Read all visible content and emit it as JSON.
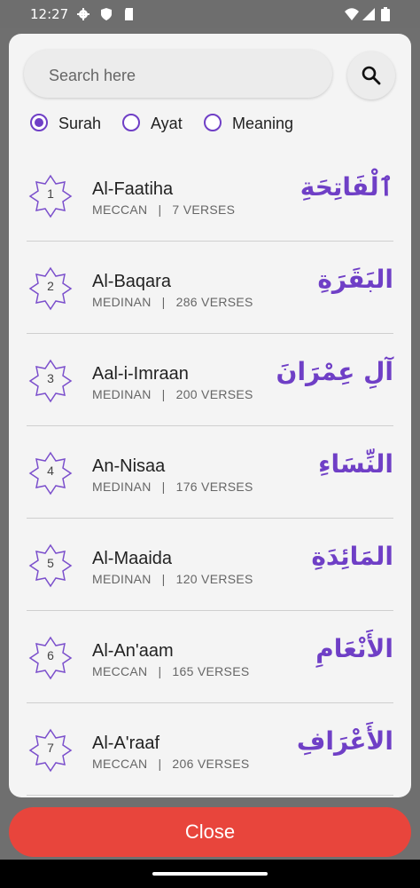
{
  "status_bar": {
    "time": "12:27",
    "icons": [
      "gear-icon",
      "shield-icon",
      "sd-card-icon",
      "wifi-icon",
      "signal-icon",
      "battery-icon"
    ]
  },
  "search": {
    "placeholder": "Search here",
    "button_icon": "search-icon"
  },
  "filters": {
    "options": [
      {
        "label": "Surah",
        "selected": true
      },
      {
        "label": "Ayat",
        "selected": false
      },
      {
        "label": "Meaning",
        "selected": false
      }
    ]
  },
  "surahs": [
    {
      "number": "1",
      "name": "Al-Faatiha",
      "type": "MECCAN",
      "verses": "7 VERSES",
      "arabic": "ٱلْفَاتِحَةِ"
    },
    {
      "number": "2",
      "name": "Al-Baqara",
      "type": "MEDINAN",
      "verses": "286 VERSES",
      "arabic": "البَقَرَةِ"
    },
    {
      "number": "3",
      "name": "Aal-i-Imraan",
      "type": "MEDINAN",
      "verses": "200 VERSES",
      "arabic": "آلِ عِمْرَانَ"
    },
    {
      "number": "4",
      "name": "An-Nisaa",
      "type": "MEDINAN",
      "verses": "176 VERSES",
      "arabic": "النِّسَاءِ"
    },
    {
      "number": "5",
      "name": "Al-Maaida",
      "type": "MEDINAN",
      "verses": "120 VERSES",
      "arabic": "المَائِدَةِ"
    },
    {
      "number": "6",
      "name": "Al-An'aam",
      "type": "MECCAN",
      "verses": "165 VERSES",
      "arabic": "الأَنْعَامِ"
    },
    {
      "number": "7",
      "name": "Al-A'raaf",
      "type": "MECCAN",
      "verses": "206 VERSES",
      "arabic": "الأَعْرَافِ"
    }
  ],
  "close_label": "Close",
  "colors": {
    "accent": "#6f3fc6",
    "close": "#e8453c"
  }
}
